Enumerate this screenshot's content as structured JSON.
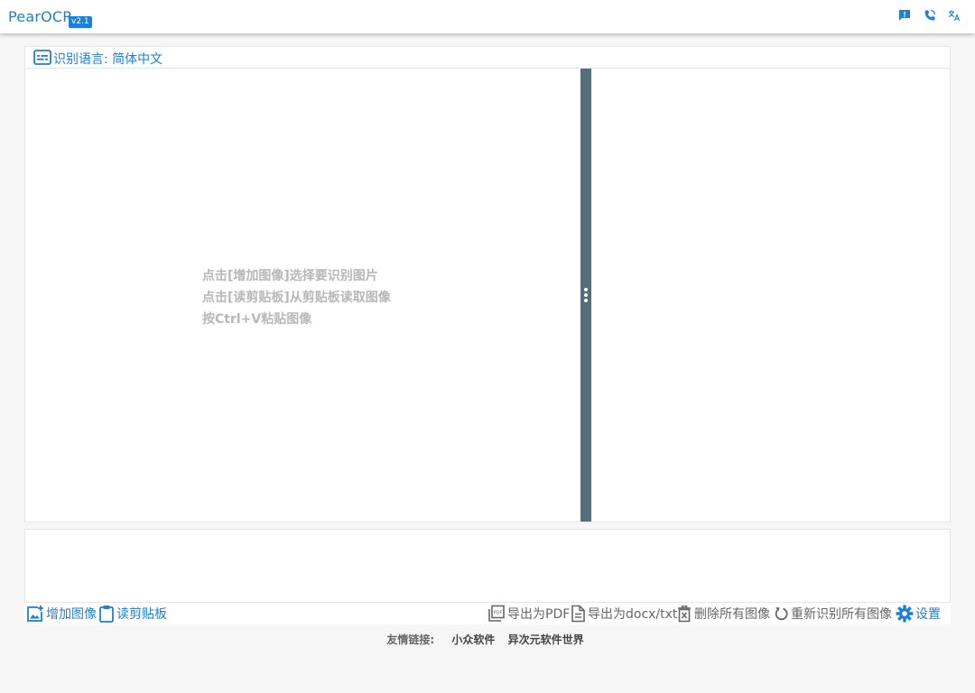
{
  "app": {
    "title": "PearOCR",
    "version": "v2.1"
  },
  "topbar": {
    "icons": [
      "feedback-icon",
      "phone-icon",
      "translate-icon"
    ]
  },
  "language": {
    "label": "识别语言: 简体中文"
  },
  "workspace": {
    "hints": [
      "点击[增加图像]选择要识别图片",
      "点击[读剪贴板]从剪贴板读取图像",
      "按Ctrl+V粘贴图像"
    ]
  },
  "toolbar": {
    "add_image": "增加图像",
    "read_clipboard": "读剪贴板",
    "export_pdf": "导出为PDF",
    "export_docx": "导出为docx/txt",
    "delete_all": "删除所有图像",
    "reocr_all": "重新识别所有图像",
    "settings": "设置"
  },
  "footer": {
    "label": "友情链接:",
    "links": [
      "小众软件",
      "异次元软件世界"
    ]
  },
  "colors": {
    "accent": "#1e7fd6",
    "splitter": "#546e7a",
    "hint": "#b8b8b8"
  }
}
